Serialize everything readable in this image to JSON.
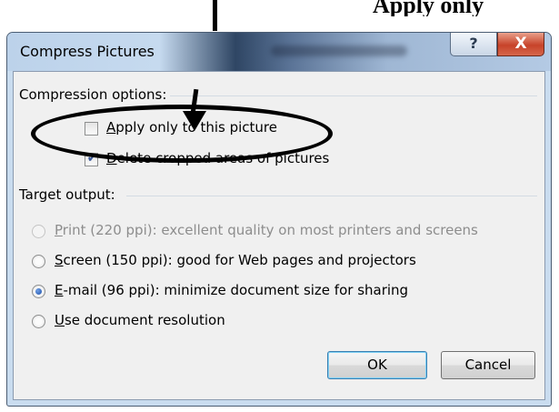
{
  "annotation": {
    "caption": "Apply only"
  },
  "window": {
    "title": "Compress Pictures",
    "help_glyph": "?",
    "close_glyph": "X"
  },
  "compression": {
    "group_label": "Compression options:",
    "apply_only": {
      "pre": "",
      "accel": "A",
      "post": "pply only to this picture",
      "checked": false
    },
    "delete_cropped": {
      "pre": "",
      "accel": "D",
      "post": "elete cropped areas of pictures",
      "checked": true
    }
  },
  "target": {
    "group_label": "Target output:",
    "options": [
      {
        "accel": "P",
        "post": "rint (220 ppi): excellent quality on most printers and screens",
        "state": "disabled"
      },
      {
        "accel": "S",
        "post": "creen (150 ppi): good for Web pages and projectors",
        "state": "unselected"
      },
      {
        "accel": "E",
        "post": "-mail (96 ppi): minimize document size for sharing",
        "state": "selected"
      },
      {
        "accel": "U",
        "post": "se document resolution",
        "state": "unselected"
      }
    ]
  },
  "buttons": {
    "ok": "OK",
    "cancel": "Cancel"
  },
  "icons": {
    "checkmark": "check-icon",
    "radio_dot": "radio-dot-icon"
  }
}
